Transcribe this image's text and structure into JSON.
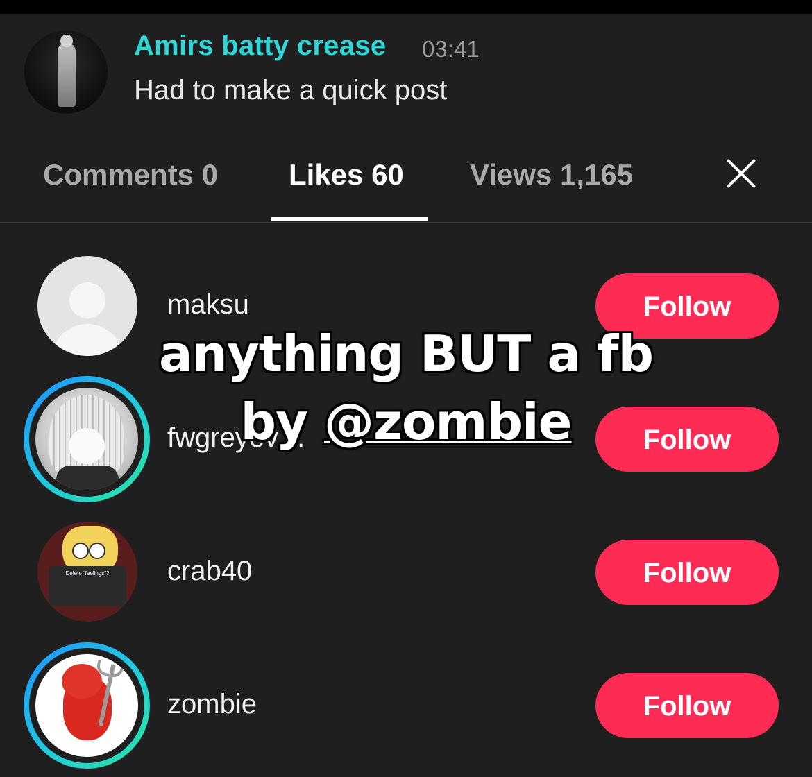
{
  "post": {
    "author": "Amirs batty crease",
    "time": "03:41",
    "caption": "Had to make a quick post"
  },
  "tabs": {
    "comments": "Comments 0",
    "likes": "Likes 60",
    "views": "Views 1,165",
    "active": "likes"
  },
  "likes_list": [
    {
      "username": "maksu",
      "button": "Follow"
    },
    {
      "username": "fwgreyev…",
      "button": "Follow"
    },
    {
      "username": "crab40",
      "button": "Follow",
      "avatar_text": "Delete “feelings”?"
    },
    {
      "username": "zombie",
      "button": "Follow"
    }
  ],
  "overlay": {
    "line1": "anything BUT a fb",
    "line2_prefix": "by ",
    "line2_mention": "@zombie"
  },
  "colors": {
    "background": "#1f1f1f",
    "author_name": "#2fd6d8",
    "follow_button": "#fe2c55"
  }
}
